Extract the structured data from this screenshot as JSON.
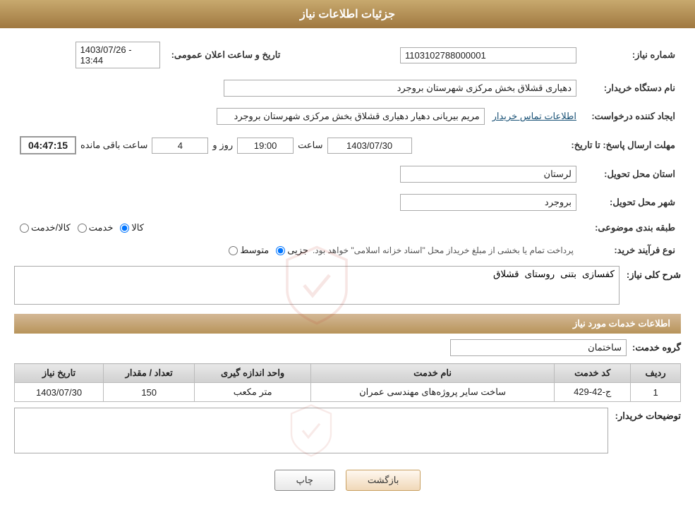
{
  "header": {
    "title": "جزئیات اطلاعات نیاز"
  },
  "fields": {
    "need_number_label": "شماره نیاز:",
    "need_number_value": "1103102788000001",
    "announcement_date_label": "تاریخ و ساعت اعلان عمومی:",
    "announcement_date_value": "1403/07/26 - 13:44",
    "buyer_org_label": "نام دستگاه خریدار:",
    "buyer_org_value": "دهیاری قشلاق بخش مرکزی شهرستان بروجرد",
    "creator_label": "ایجاد کننده درخواست:",
    "creator_value": "مریم بیریانی دهیار دهیاری قشلاق بخش مرکزی شهرستان بروجرد",
    "contact_link": "اطلاعات تماس خریدار",
    "response_deadline_label": "مهلت ارسال پاسخ: تا تاریخ:",
    "response_date": "1403/07/30",
    "response_time_label": "ساعت",
    "response_time": "19:00",
    "response_days_label": "روز و",
    "response_days": "4",
    "countdown_label": "ساعت باقی مانده",
    "countdown_value": "04:47:15",
    "delivery_province_label": "استان محل تحویل:",
    "delivery_province_value": "لرستان",
    "delivery_city_label": "شهر محل تحویل:",
    "delivery_city_value": "بروجرد",
    "category_label": "طبقه بندی موضوعی:",
    "category_options": [
      "کالا",
      "خدمت",
      "کالا/خدمت"
    ],
    "category_selected": "کالا",
    "purchase_type_label": "نوع فرآیند خرید:",
    "purchase_type_options": [
      "جزیی",
      "متوسط"
    ],
    "purchase_type_note": "پرداخت تمام یا بخشی از مبلغ خریداز محل \"اسناد خزانه اسلامی\" خواهد بود.",
    "need_description_label": "شرح کلی نیاز:",
    "need_description_value": "کفسازی بتنی روستای قشلاق",
    "services_section_title": "اطلاعات خدمات مورد نیاز",
    "group_service_label": "گروه خدمت:",
    "group_service_value": "ساختمان",
    "table_headers": [
      "ردیف",
      "کد خدمت",
      "نام خدمت",
      "واحد اندازه گیری",
      "تعداد / مقدار",
      "تاریخ نیاز"
    ],
    "table_rows": [
      {
        "row": "1",
        "code": "ج-42-429",
        "name": "ساخت سایر پروژه‌های مهندسی عمران",
        "unit": "متر مکعب",
        "quantity": "150",
        "date": "1403/07/30"
      }
    ],
    "buyer_notes_label": "توضیحات خریدار:",
    "buyer_notes_value": "",
    "btn_print": "چاپ",
    "btn_back": "بازگشت"
  }
}
